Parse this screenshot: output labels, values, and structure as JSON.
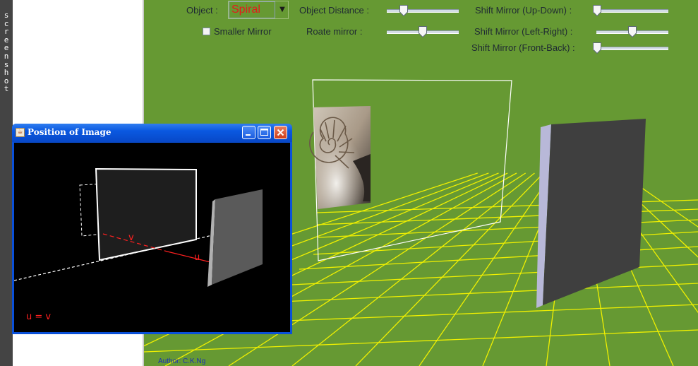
{
  "left_strip": {
    "vertical_text_chars": [
      "s",
      "c",
      "r",
      "e",
      "e",
      "n",
      "s",
      "h",
      "o",
      "t"
    ]
  },
  "controls": {
    "object_label": "Object :",
    "object_value": "Spiral",
    "object_distance_label": "Object Distance :",
    "object_distance_level": 0.2,
    "shift_updown_label": "Shift Mirror (Up-Down) :",
    "shift_updown_level": 0.0,
    "smaller_mirror_label": "Smaller Mirror",
    "smaller_mirror_checked": false,
    "rotate_mirror_label": "Roate mirror :",
    "rotate_mirror_level": 0.5,
    "shift_leftright_label": "Shift Mirror (Left-Right) :",
    "shift_leftright_level": 0.5,
    "shift_frontback_label": "Shift Mirror (Front-Back) :",
    "shift_frontback_level": 0.0
  },
  "popup": {
    "title": "Position of Image",
    "label_v": "v",
    "label_u": "u",
    "equation": "u = v",
    "buttons": {
      "minimize_icon": "minimize-icon",
      "maximize_icon": "maximize-icon",
      "close_icon": "close-icon"
    }
  },
  "author": "Author: C.K.Ng",
  "colors": {
    "applet_bg": "#669933",
    "grid": "#f0f000",
    "object_text": "#e31b1b",
    "label_red": "#ff2020",
    "mirror": "#3f3f3f"
  }
}
